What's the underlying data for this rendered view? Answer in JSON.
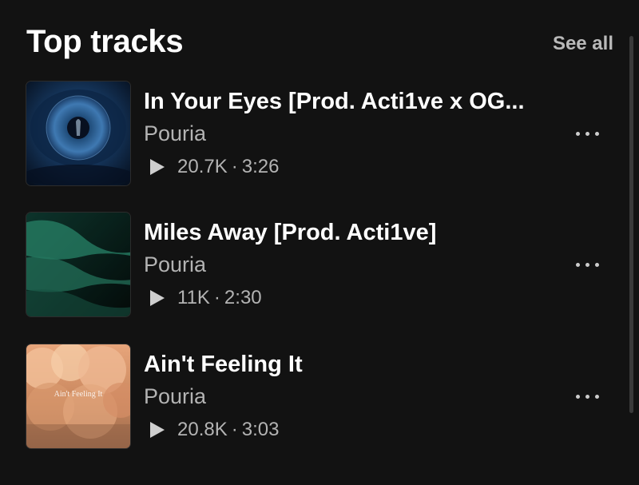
{
  "section": {
    "title": "Top tracks",
    "see_all_label": "See all"
  },
  "icons": {
    "play": "play-icon",
    "more": "more-options-icon"
  },
  "tracks": [
    {
      "title": "In Your Eyes [Prod. Acti1ve x OG...",
      "artist": "Pouria",
      "plays": "20.7K",
      "duration": "3:26",
      "cover": "blue-eye-artwork"
    },
    {
      "title": "Miles Away [Prod. Acti1ve]",
      "artist": "Pouria",
      "plays": "11K",
      "duration": "2:30",
      "cover": "green-wave-artwork"
    },
    {
      "title": "Ain't Feeling It",
      "artist": "Pouria",
      "plays": "20.8K",
      "duration": "3:03",
      "cover": "clouds-artwork",
      "cover_text": "Ain't Feeling It"
    }
  ],
  "colors": {
    "background": "#121212",
    "primary_text": "#ffffff",
    "secondary_text": "#b3b3b3"
  }
}
